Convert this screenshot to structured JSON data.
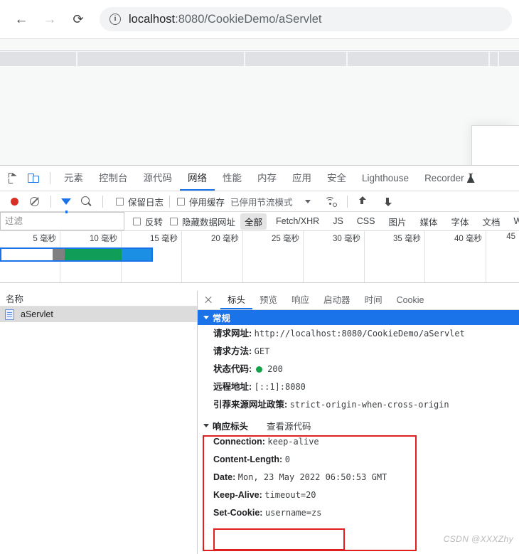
{
  "browser": {
    "back_icon": "arrow-left-icon",
    "forward_icon": "arrow-right-icon",
    "reload_icon": "reload-icon",
    "site_info_icon": "info-circle-icon",
    "url_host": "localhost",
    "url_rest": ":8080/CookieDemo/aServlet",
    "url_full": "localhost:8080/CookieDemo/aServlet"
  },
  "devtools": {
    "toolbar_icons": [
      "inspect-element-icon",
      "device-toolbar-icon"
    ],
    "panels": [
      {
        "label": "元素",
        "active": false
      },
      {
        "label": "控制台",
        "active": false
      },
      {
        "label": "源代码",
        "active": false
      },
      {
        "label": "网络",
        "active": true
      },
      {
        "label": "性能",
        "active": false
      },
      {
        "label": "内存",
        "active": false
      },
      {
        "label": "应用",
        "active": false
      },
      {
        "label": "安全",
        "active": false
      },
      {
        "label": "Lighthouse",
        "active": false
      },
      {
        "label": "Recorder",
        "active": false,
        "icon": "flask-icon"
      }
    ],
    "controls": {
      "record_icon": "record-dot-icon",
      "clear_icon": "clear-network-log-icon",
      "filter_icon": "filter-funnel-icon",
      "search_icon": "search-icon",
      "preserve_log_label": "保留日志",
      "preserve_log_checked": false,
      "disable_cache_label": "停用缓存",
      "disable_cache_checked": false,
      "throttling_label": "已停用节流模式",
      "throttling_caret_icon": "chevron-down-icon",
      "network_conditions_icon": "wifi-settings-icon",
      "import_har_icon": "arrow-up-icon",
      "export_har_icon": "arrow-down-icon"
    },
    "filter_row": {
      "filter_placeholder": "过滤",
      "filter_value": "",
      "invert_label": "反转",
      "invert_checked": false,
      "hide_data_urls_label": "隐藏数据网址",
      "hide_data_urls_checked": false,
      "types": [
        "全部",
        "Fetch/XHR",
        "JS",
        "CSS",
        "图片",
        "媒体",
        "字体",
        "文档",
        "WS"
      ],
      "selected_type": "全部"
    },
    "overview": {
      "tick_labels": [
        "5 毫秒",
        "10 毫秒",
        "15 毫秒",
        "20 毫秒",
        "25 毫秒",
        "30 毫秒",
        "35 毫秒",
        "40 毫秒",
        "45"
      ],
      "bar_segments": [
        {
          "name": "waiting",
          "color": "#ffffff",
          "start_pct": 0,
          "width_pct": 34
        },
        {
          "name": "stalled",
          "color": "#808080",
          "start_pct": 34,
          "width_pct": 8
        },
        {
          "name": "download",
          "color": "#0f9d58",
          "start_pct": 42,
          "width_pct": 38
        },
        {
          "name": "total",
          "color": "#1a8fe3",
          "start_pct": 80,
          "width_pct": 20
        }
      ],
      "bar_end_pct": 29.5,
      "border_color": "#1a73e8"
    },
    "request_list": {
      "column_header": "名称",
      "rows": [
        {
          "name": "aServlet",
          "icon": "document-icon",
          "selected": true
        }
      ]
    },
    "detail": {
      "close_icon": "close-icon",
      "tabs": [
        {
          "label": "标头",
          "active": true
        },
        {
          "label": "预览",
          "active": false
        },
        {
          "label": "响应",
          "active": false
        },
        {
          "label": "启动器",
          "active": false
        },
        {
          "label": "时间",
          "active": false
        },
        {
          "label": "Cookie",
          "active": false
        }
      ],
      "general": {
        "title": "常规",
        "expanded": true,
        "rows": [
          {
            "key": "请求网址:",
            "value": "http://localhost:8080/CookieDemo/aServlet"
          },
          {
            "key": "请求方法:",
            "value": "GET"
          },
          {
            "key": "状态代码:",
            "value": "200",
            "status_dot": "#15a349"
          },
          {
            "key": "远程地址:",
            "value": "[::1]:8080"
          },
          {
            "key": "引荐来源网址政策:",
            "value": "strict-origin-when-cross-origin"
          }
        ]
      },
      "response_headers": {
        "title": "响应标头",
        "expanded": true,
        "view_source_label": "查看源代码",
        "rows": [
          {
            "key": "Connection:",
            "value": "keep-alive"
          },
          {
            "key": "Content-Length:",
            "value": "0"
          },
          {
            "key": "Date:",
            "value": "Mon, 23 May 2022 06:50:53 GMT"
          },
          {
            "key": "Keep-Alive:",
            "value": "timeout=20"
          },
          {
            "key": "Set-Cookie:",
            "value": "username=zs",
            "highlighted": true
          }
        ]
      }
    }
  },
  "annotations": {
    "highlight_color": "#e02020",
    "watermark": "CSDN @XXXZhy"
  }
}
